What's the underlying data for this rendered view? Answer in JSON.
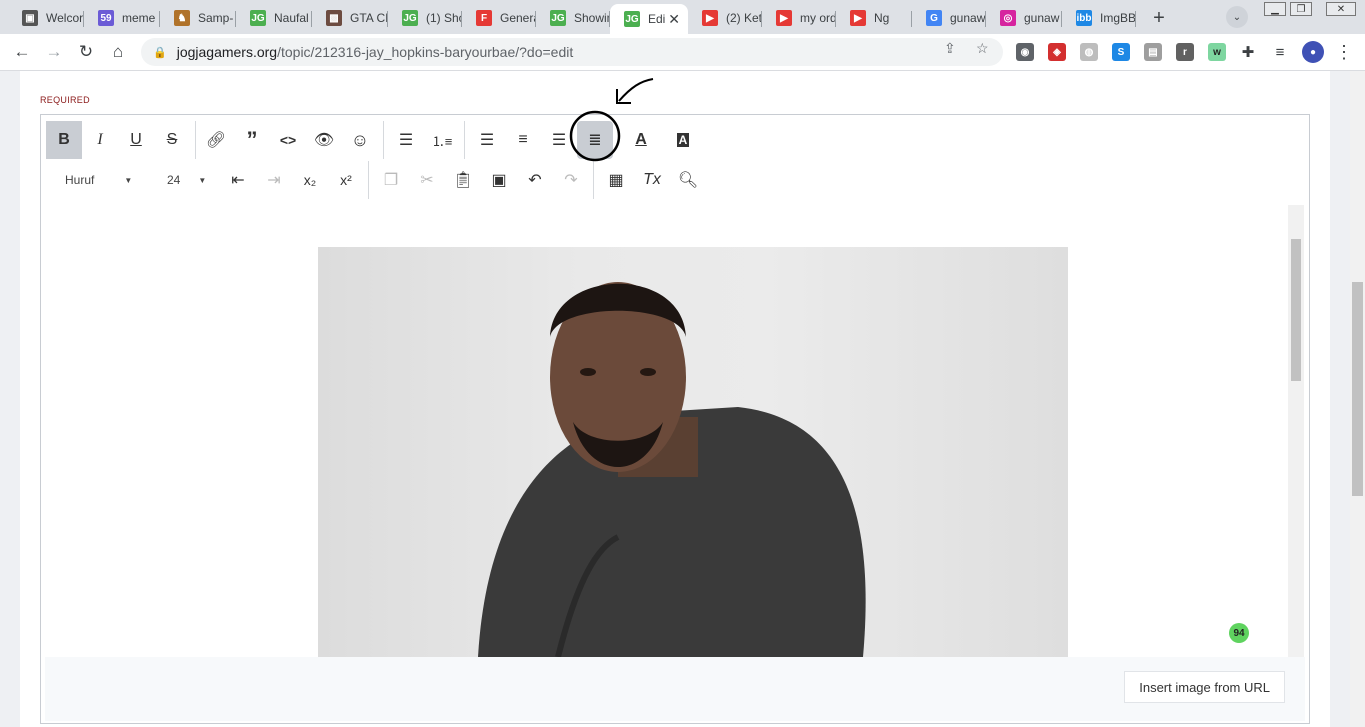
{
  "tabs": [
    {
      "label": "Welcor",
      "fav": "#555",
      "glyph": "▣"
    },
    {
      "label": "meme",
      "fav": "#6b5bd6",
      "glyph": "59"
    },
    {
      "label": "Samp-",
      "fav": "#b0722a",
      "glyph": "♞"
    },
    {
      "label": "Naufal",
      "fav": "#4caf50",
      "glyph": "JG"
    },
    {
      "label": "GTA CI",
      "fav": "#6d4c41",
      "glyph": "▩"
    },
    {
      "label": "(1) Sho",
      "fav": "#4caf50",
      "glyph": "JG"
    },
    {
      "label": "Genera",
      "fav": "#e53935",
      "glyph": "F"
    },
    {
      "label": "Showin",
      "fav": "#4caf50",
      "glyph": "JG"
    },
    {
      "label": "Edi",
      "fav": "#4caf50",
      "glyph": "JG",
      "active": true
    },
    {
      "label": "(2) Ket",
      "fav": "#e53935",
      "glyph": "▶"
    },
    {
      "label": "my ord",
      "fav": "#e53935",
      "glyph": "▶"
    },
    {
      "label": "Ng",
      "fav": "#e53935",
      "glyph": "▶"
    },
    {
      "label": "gunaw",
      "fav": "#4285f4",
      "glyph": "G"
    },
    {
      "label": "gunaw",
      "fav": "#d6249f",
      "glyph": "◎"
    },
    {
      "label": "ImgBB",
      "fav": "#1e88e5",
      "glyph": "ibb"
    }
  ],
  "url": {
    "domain": "jogjagamers.org",
    "path": "/topic/212316-jay_hopkins-baryourbae/?do=edit"
  },
  "form": {
    "required_label": "REQUIRED"
  },
  "editor": {
    "font_name": "Huruf",
    "font_size": "24",
    "insert_image_label": "Insert image from URL",
    "badge_count": "94"
  },
  "colors": {
    "accent": "#1e88e5",
    "active_button": "#c9cdd3",
    "required": "#8b1a1a",
    "badge": "#5fd35f"
  }
}
